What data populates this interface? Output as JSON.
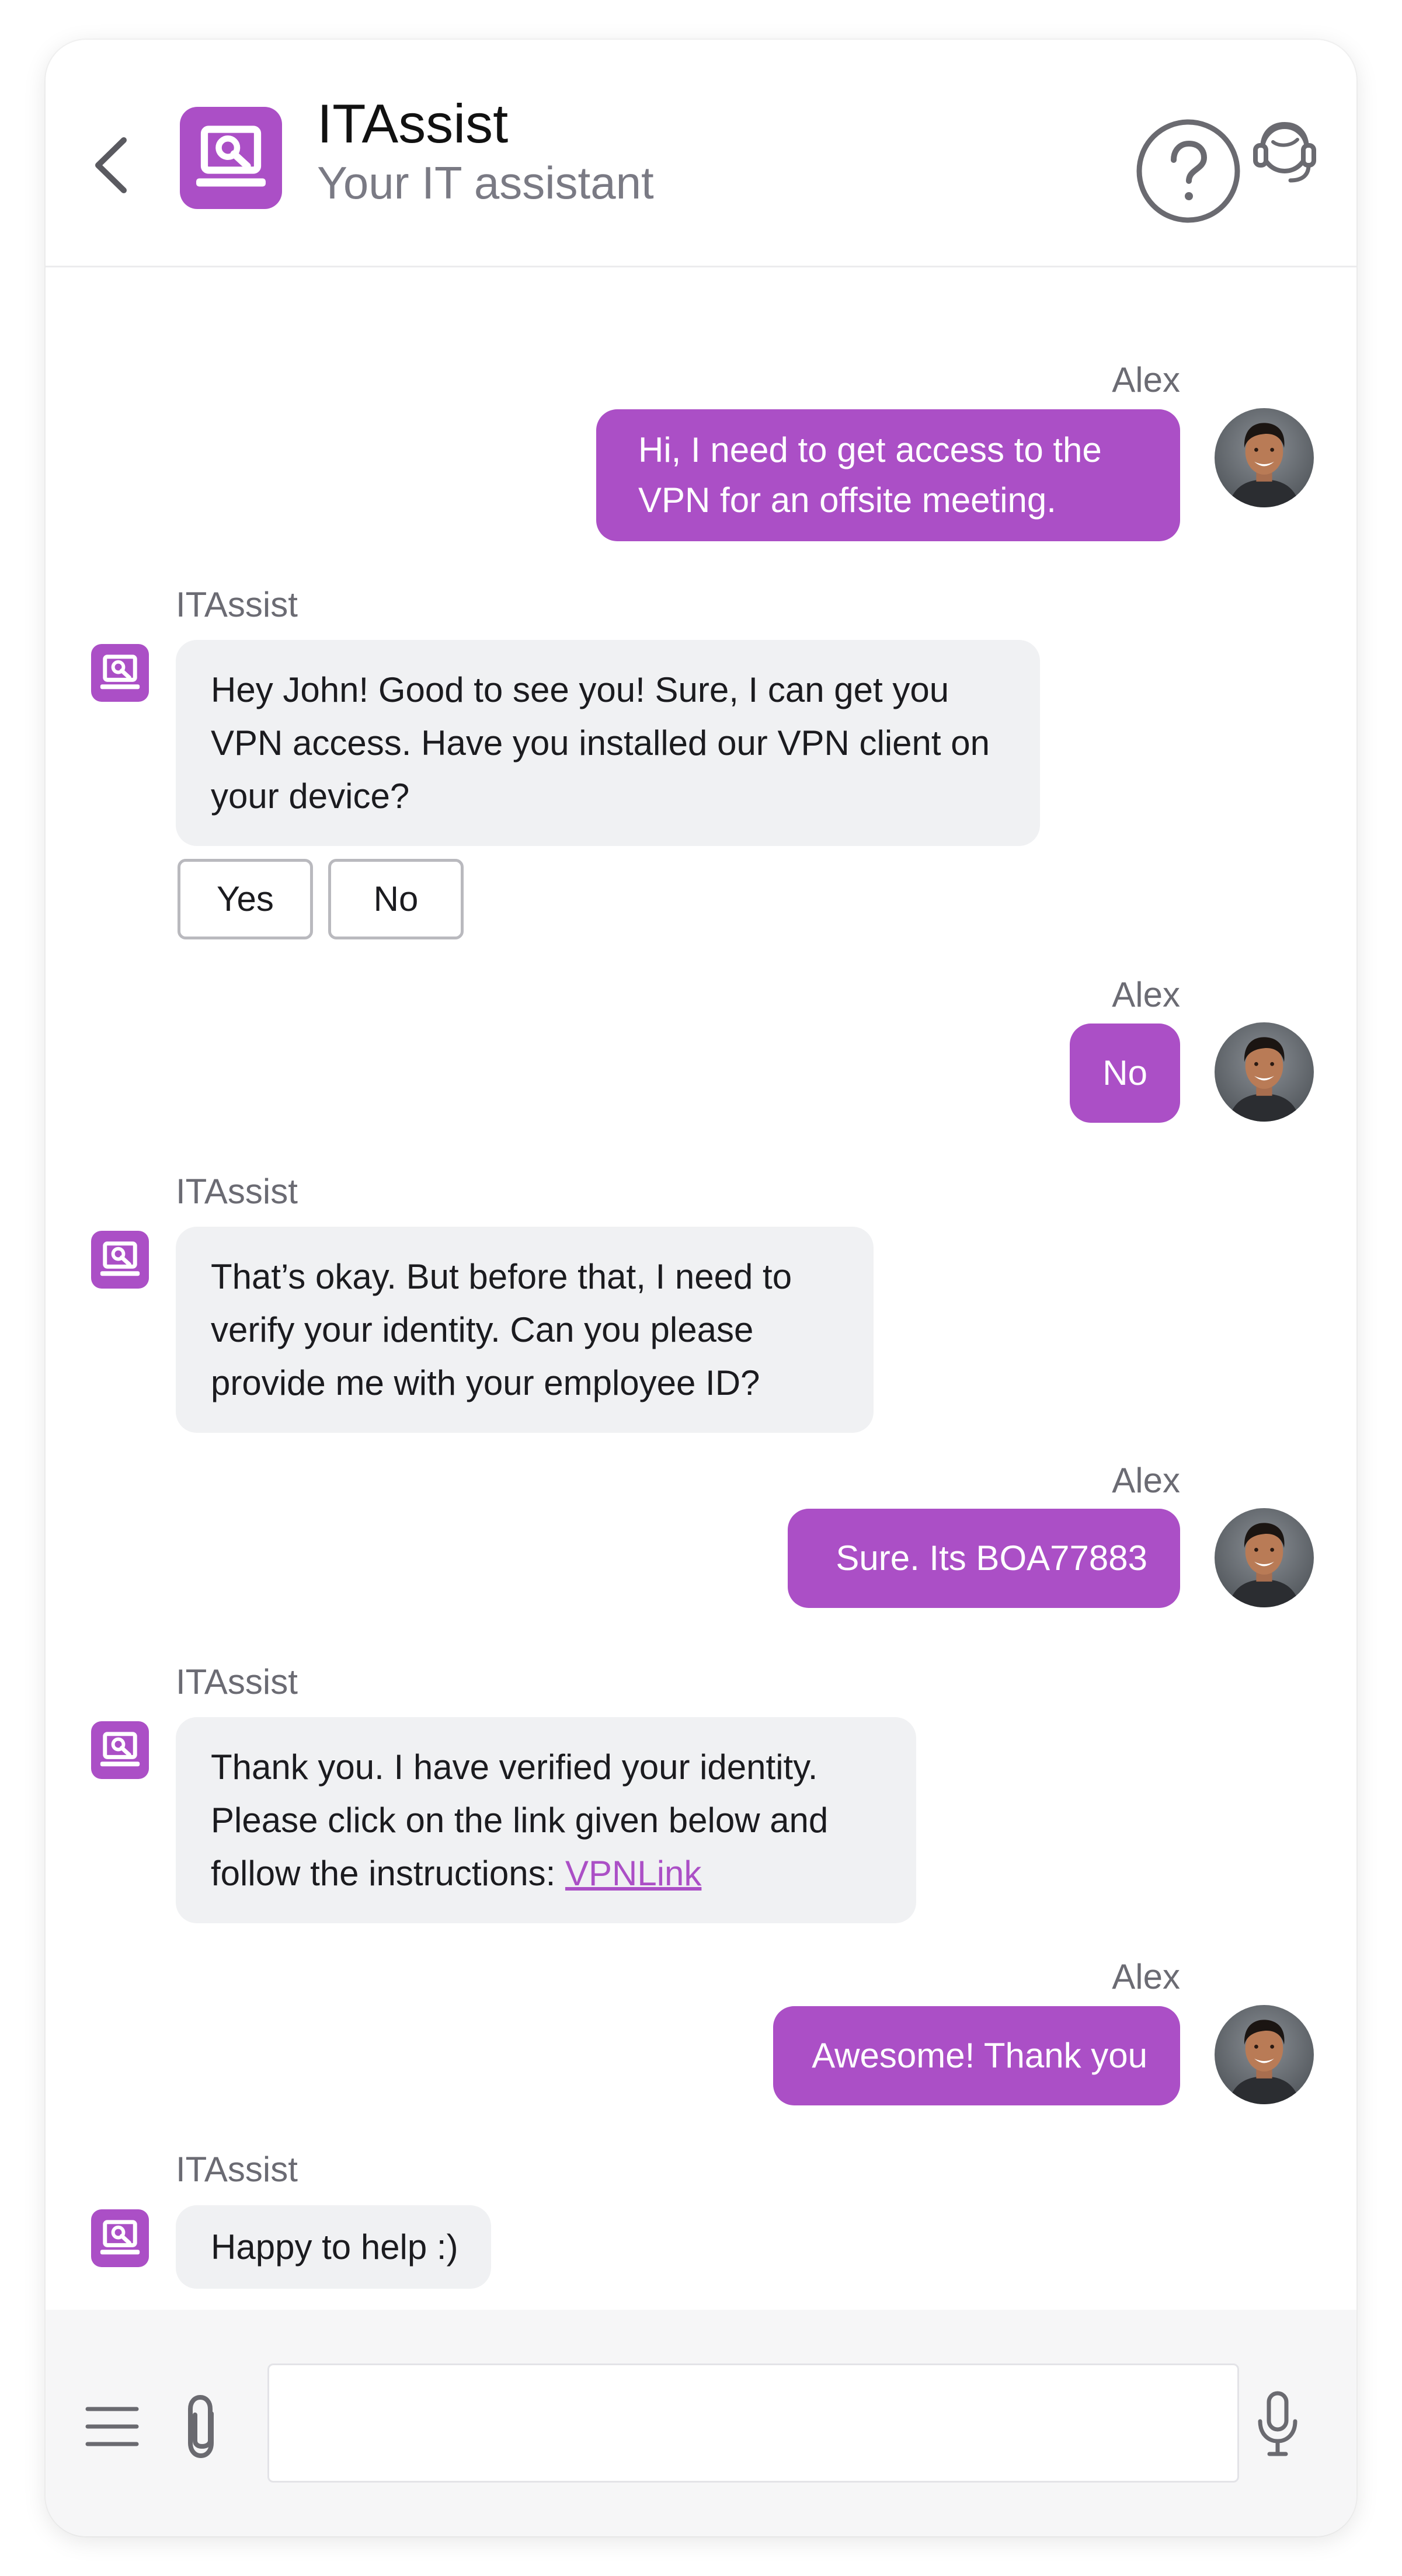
{
  "header": {
    "title": "ITAssist",
    "subtitle": "Your IT assistant"
  },
  "colors": {
    "accent": "#ab4fc6",
    "bot_bubble": "#f0f1f3",
    "muted_text": "#6b6b73"
  },
  "icons": {
    "back": "chevron-left-icon",
    "logo": "laptop-wrench-icon",
    "help": "question-circle-icon",
    "agent": "headset-agent-icon",
    "menu": "hamburger-menu-icon",
    "attach": "paperclip-icon",
    "mic": "microphone-icon"
  },
  "messages": [
    {
      "sender": "Alex",
      "text": "Hi, I need to get access to the VPN for an offsite meeting."
    },
    {
      "sender": "ITAssist",
      "text": "Hey John! Good to see you! Sure, I can get you VPN access. Have you installed our VPN client on your device?"
    },
    {
      "sender": "Alex",
      "text": "No"
    },
    {
      "sender": "ITAssist",
      "text": "That’s okay. But before that, I need to verify your identity. Can you please provide me with your employee ID?"
    },
    {
      "sender": "Alex",
      "text": "Sure. Its BOA77883"
    },
    {
      "sender": "ITAssist",
      "text": "Thank you. I have verified your identity. Please click on the link given below and follow the instructions:",
      "link": "VPNLink"
    },
    {
      "sender": "Alex",
      "text": "Awesome! Thank you"
    },
    {
      "sender": "ITAssist",
      "text": "Happy to help :)"
    }
  ],
  "quick_replies": [
    "Yes",
    "No"
  ],
  "composer": {
    "value": "",
    "placeholder": ""
  }
}
